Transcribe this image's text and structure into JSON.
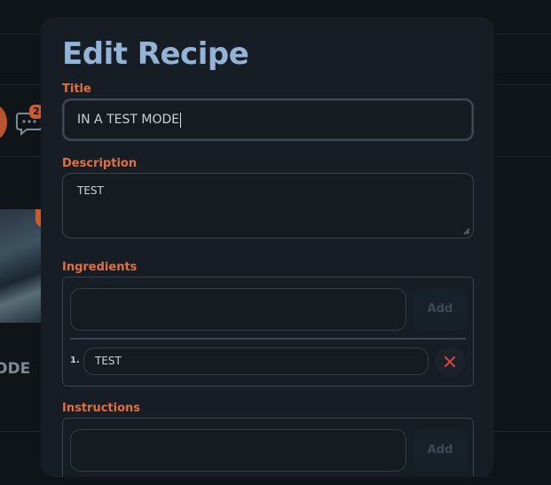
{
  "background": {
    "badge_count": "2",
    "card_caption": "ODE"
  },
  "modal": {
    "title": "Edit Recipe",
    "fields": {
      "title_label": "Title",
      "title_value": "IN A TEST MODE",
      "description_label": "Description",
      "description_value": "TEST"
    },
    "ingredients": {
      "label": "Ingredients",
      "new_value": "",
      "add_label": "Add",
      "items": [
        {
          "number": "1.",
          "value": "TEST"
        }
      ]
    },
    "instructions": {
      "label": "Instructions",
      "new_value": "",
      "add_label": "Add"
    }
  },
  "colors": {
    "accent_label": "#e0703f",
    "title_color": "#93b4d6",
    "remove_icon": "#e0453f"
  },
  "icons": {
    "chat": "chat-bubble-icon",
    "remove": "close-icon"
  }
}
